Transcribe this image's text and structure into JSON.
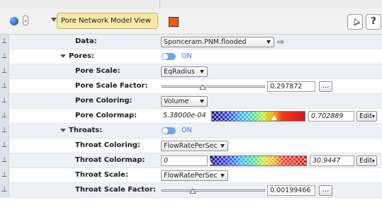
{
  "header": {
    "view_label": "Pore Network Model View",
    "swatch_color": "#f25a0f",
    "help_label": "?",
    "icons": [
      "globe-icon",
      "lock-icon",
      "collapse-arrow-icon",
      "pointer-cursor-icon",
      "help-icon"
    ]
  },
  "pin_glyph": "⊥",
  "props": {
    "data": {
      "label": "Data:",
      "value": "Sponceram.PNM.flooded",
      "link_glyph": "⇨"
    },
    "pores": {
      "label": "Pores:",
      "toggle": "ON"
    },
    "pore_scale": {
      "label": "Pore Scale:",
      "value": "EqRadius"
    },
    "pore_scale_factor": {
      "label": "Pore Scale Factor:",
      "value": "0.297872",
      "slider_fraction": 0.4,
      "button": "..."
    },
    "pore_coloring": {
      "label": "Pore Coloring:",
      "value": "Volume"
    },
    "pore_colormap": {
      "label": "Pore Colormap:",
      "min": "5.38000e-04",
      "max": "0.702889",
      "edit": "Edit"
    },
    "throats": {
      "label": "Throats:",
      "toggle": "ON"
    },
    "throat_coloring": {
      "label": "Throat Coloring:",
      "value": "FlowRatePerSec"
    },
    "throat_colormap": {
      "label": "Throat Colormap:",
      "min": "0",
      "max": "30.9447",
      "edit": "Edit"
    },
    "throat_scale": {
      "label": "Throat Scale:",
      "value": "FlowRatePerSec"
    },
    "throat_scale_factor": {
      "label": "Throat Scale Factor:",
      "value": "0.00199466",
      "slider_fraction": 0.3,
      "button": "..."
    }
  },
  "colors": {
    "toggle_on": "#6fa6e0",
    "toggle_text": "#3577c7",
    "header_label_bg": "#f7e9a8",
    "row_band": "#eef0f7"
  }
}
